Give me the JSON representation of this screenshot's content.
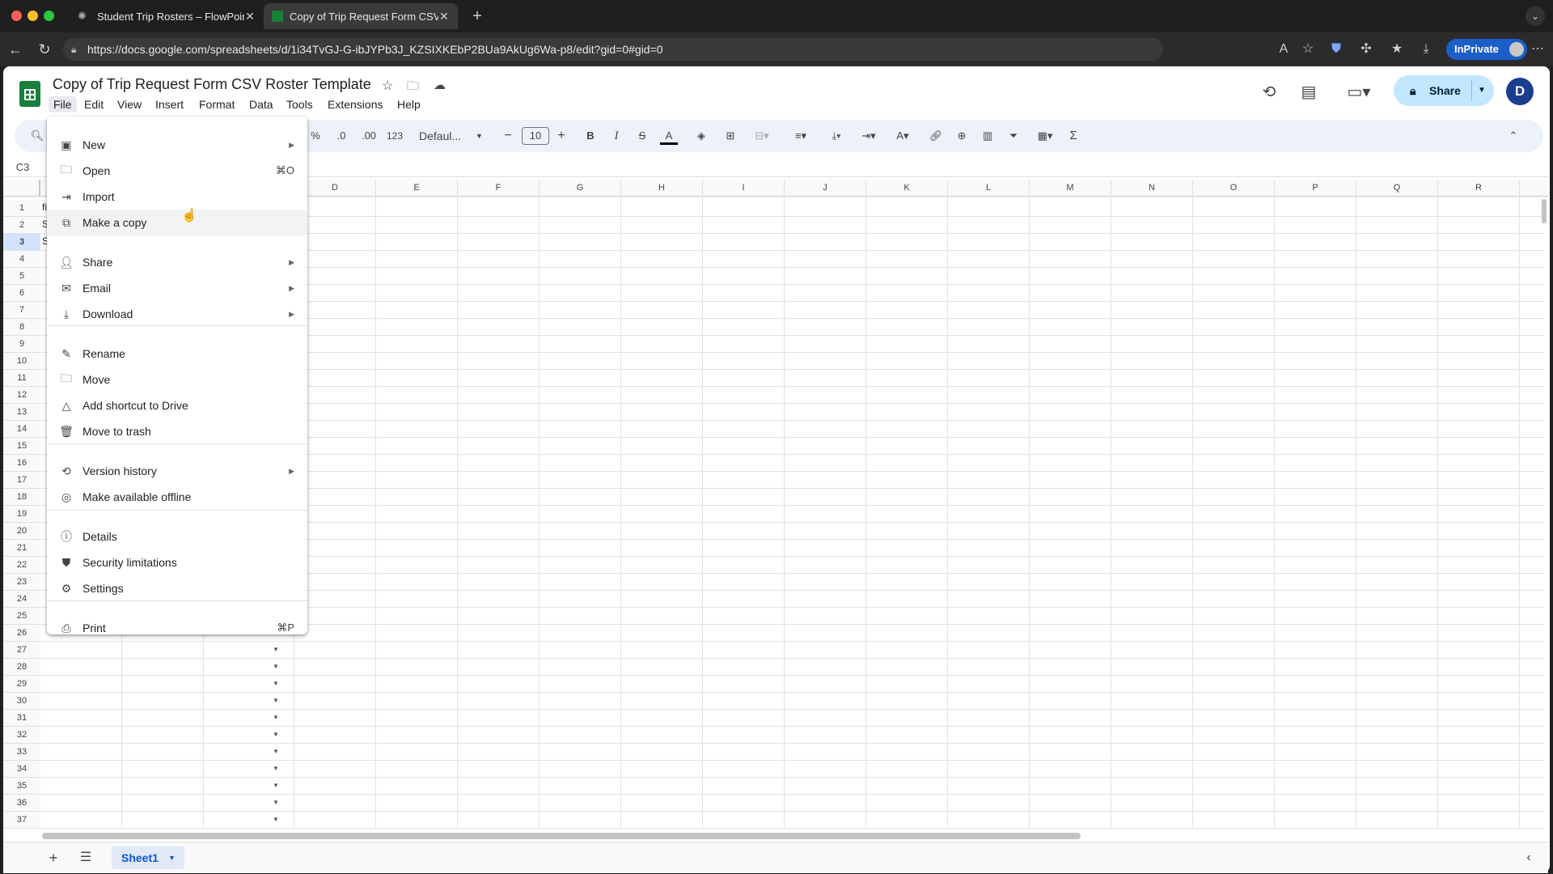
{
  "browser": {
    "tabs": [
      {
        "label": "Student Trip Rosters – FlowPoint",
        "active": false
      },
      {
        "label": "Copy of Trip Request Form CSV",
        "active": true
      }
    ],
    "new_tab": "+",
    "url": "https://docs.google.com/spreadsheets/d/1i34TvGJ-G-ibJYPb3J_KZSIXKEbP2BUa9AkUg6Wa-p8/edit?gid=0#gid=0",
    "inprivate": "InPrivate"
  },
  "doc": {
    "title": "Copy of Trip Request Form CSV Roster Template",
    "menus": [
      "File",
      "Edit",
      "View",
      "Insert",
      "Format",
      "Data",
      "Tools",
      "Extensions",
      "Help"
    ],
    "share": "Share",
    "avatar": "D"
  },
  "toolbar": {
    "percent": "%",
    "dec_decrease": ".0",
    "dec_increase": ".00",
    "number_format": "123",
    "font": "Defaul...",
    "font_size": "10",
    "minus": "−",
    "plus": "+",
    "bold": "B",
    "italic": "I",
    "strike": "S",
    "text_color": "A",
    "sum": "Σ"
  },
  "name_box": "C3",
  "columns": [
    "D",
    "E",
    "F",
    "G",
    "H",
    "I",
    "J",
    "K",
    "L",
    "M",
    "N",
    "O",
    "P",
    "Q",
    "R"
  ],
  "rows": [
    "1",
    "2",
    "3",
    "4",
    "5",
    "6",
    "7",
    "8",
    "9",
    "10",
    "11",
    "12",
    "13",
    "14",
    "15",
    "16",
    "17",
    "18",
    "19",
    "20",
    "21",
    "22",
    "23",
    "24",
    "25",
    "26",
    "27",
    "28",
    "29",
    "30",
    "31",
    "32",
    "33",
    "34",
    "35",
    "36",
    "37"
  ],
  "visible_cells": {
    "r1": "fi",
    "r2": "S",
    "r3": "S"
  },
  "file_menu": {
    "items": [
      {
        "label": "New",
        "icon": "plus-sheet-icon",
        "submenu": true
      },
      {
        "label": "Open",
        "icon": "folder-icon",
        "shortcut": "⌘O"
      },
      {
        "label": "Import",
        "icon": "import-icon"
      },
      {
        "label": "Make a copy",
        "icon": "copy-icon"
      },
      {
        "label": "Share",
        "icon": "person-add-icon",
        "submenu": true
      },
      {
        "label": "Email",
        "icon": "email-icon",
        "submenu": true
      },
      {
        "label": "Download",
        "icon": "download-icon",
        "submenu": true
      },
      {
        "label": "Rename",
        "icon": "pencil-icon"
      },
      {
        "label": "Move",
        "icon": "move-folder-icon"
      },
      {
        "label": "Add shortcut to Drive",
        "icon": "drive-shortcut-icon"
      },
      {
        "label": "Move to trash",
        "icon": "trash-icon"
      },
      {
        "label": "Version history",
        "icon": "history-icon",
        "submenu": true
      },
      {
        "label": "Make available offline",
        "icon": "offline-icon"
      },
      {
        "label": "Details",
        "icon": "info-icon"
      },
      {
        "label": "Security limitations",
        "icon": "shield-icon"
      },
      {
        "label": "Settings",
        "icon": "gear-icon"
      },
      {
        "label": "Print",
        "icon": "print-icon",
        "shortcut": "⌘P"
      }
    ]
  },
  "sheet_tab": "Sheet1",
  "colors": {
    "accent": "#0b57d0",
    "share_bg": "#c2e7ff",
    "sheets_green": "#188038"
  }
}
